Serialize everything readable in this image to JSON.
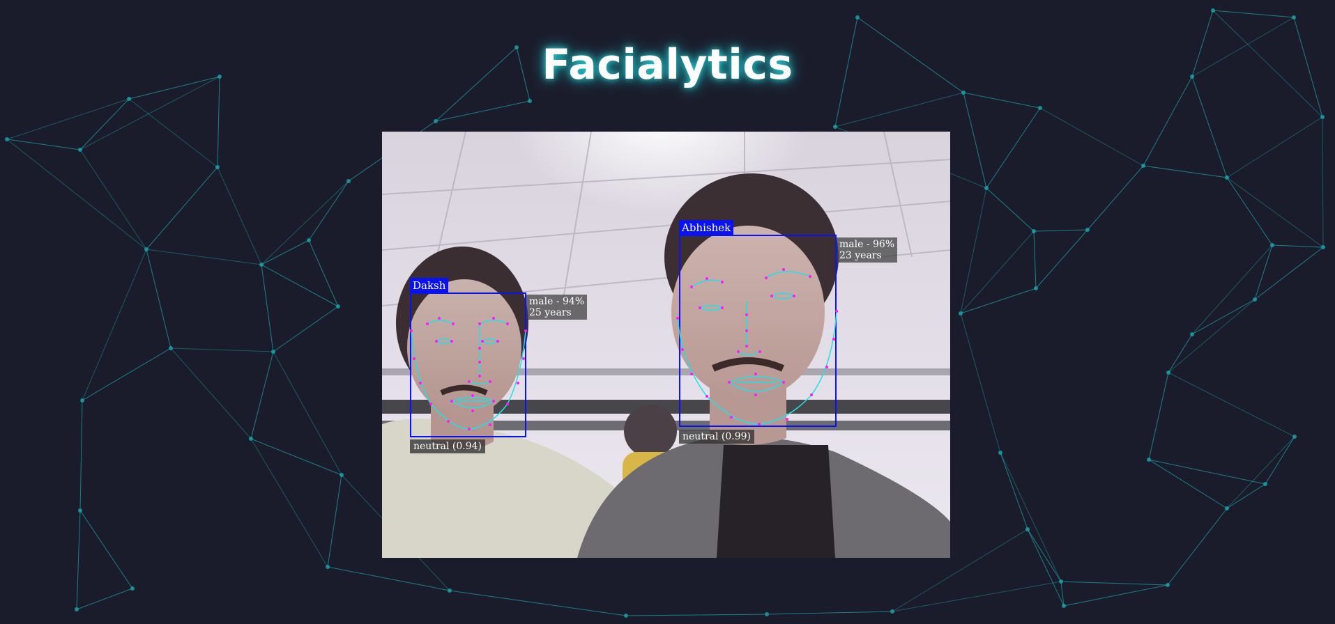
{
  "app": {
    "title": "Facialytics"
  },
  "colors": {
    "background": "#1b1c2b",
    "network_lines": "#1aa6ad",
    "box": "#0a12f0",
    "landmark_lines": "#21e0e6",
    "landmark_points": "#ff1aff",
    "title_glow": "#2ad0d6"
  },
  "detections": [
    {
      "name": "Daksh",
      "gender_line": "male - 94%",
      "age_line": "25 years",
      "expression": "neutral (0.94)"
    },
    {
      "name": "Abhishek",
      "gender_line": "male - 96%",
      "age_line": "23 years",
      "expression": "neutral (0.99)"
    }
  ]
}
